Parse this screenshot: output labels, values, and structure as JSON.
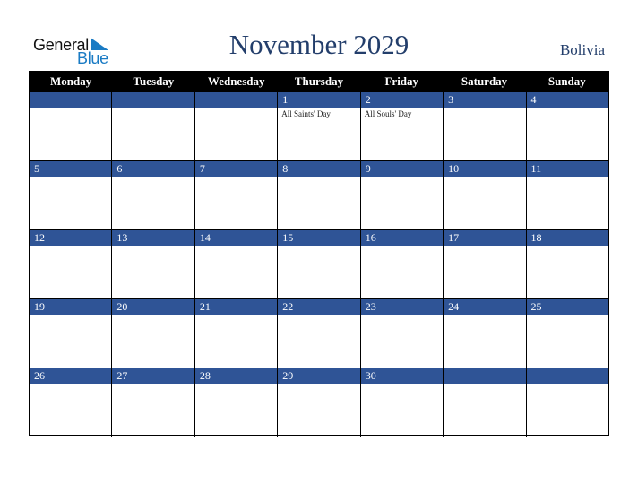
{
  "logo": {
    "line1": "General",
    "line2": "Blue",
    "accent": "#1a7bc4"
  },
  "title": "November 2029",
  "country": "Bolivia",
  "colors": {
    "title": "#233e6b",
    "day_bar": "#2f5496",
    "header_bg": "#000000"
  },
  "weekdays": [
    "Monday",
    "Tuesday",
    "Wednesday",
    "Thursday",
    "Friday",
    "Saturday",
    "Sunday"
  ],
  "weeks": [
    [
      {
        "day": "",
        "event": ""
      },
      {
        "day": "",
        "event": ""
      },
      {
        "day": "",
        "event": ""
      },
      {
        "day": "1",
        "event": "All Saints' Day"
      },
      {
        "day": "2",
        "event": "All Souls' Day"
      },
      {
        "day": "3",
        "event": ""
      },
      {
        "day": "4",
        "event": ""
      }
    ],
    [
      {
        "day": "5",
        "event": ""
      },
      {
        "day": "6",
        "event": ""
      },
      {
        "day": "7",
        "event": ""
      },
      {
        "day": "8",
        "event": ""
      },
      {
        "day": "9",
        "event": ""
      },
      {
        "day": "10",
        "event": ""
      },
      {
        "day": "11",
        "event": ""
      }
    ],
    [
      {
        "day": "12",
        "event": ""
      },
      {
        "day": "13",
        "event": ""
      },
      {
        "day": "14",
        "event": ""
      },
      {
        "day": "15",
        "event": ""
      },
      {
        "day": "16",
        "event": ""
      },
      {
        "day": "17",
        "event": ""
      },
      {
        "day": "18",
        "event": ""
      }
    ],
    [
      {
        "day": "19",
        "event": ""
      },
      {
        "day": "20",
        "event": ""
      },
      {
        "day": "21",
        "event": ""
      },
      {
        "day": "22",
        "event": ""
      },
      {
        "day": "23",
        "event": ""
      },
      {
        "day": "24",
        "event": ""
      },
      {
        "day": "25",
        "event": ""
      }
    ],
    [
      {
        "day": "26",
        "event": ""
      },
      {
        "day": "27",
        "event": ""
      },
      {
        "day": "28",
        "event": ""
      },
      {
        "day": "29",
        "event": ""
      },
      {
        "day": "30",
        "event": ""
      },
      {
        "day": "",
        "event": ""
      },
      {
        "day": "",
        "event": ""
      }
    ]
  ]
}
